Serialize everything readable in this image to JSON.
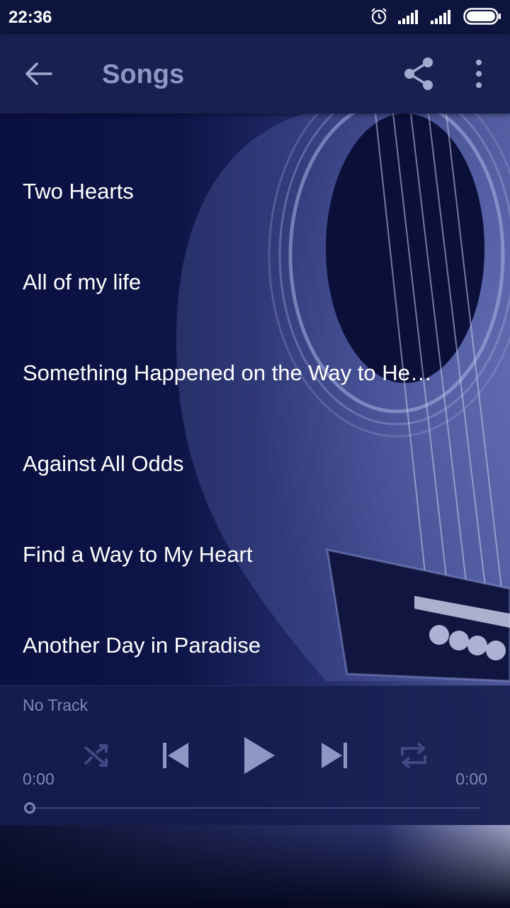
{
  "statusbar": {
    "time": "22:36"
  },
  "appbar": {
    "title": "Songs"
  },
  "songs": [
    {
      "title": "Two Hearts"
    },
    {
      "title": "All of my life"
    },
    {
      "title": "Something Happened on the Way to Heaven"
    },
    {
      "title": "Against All Odds"
    },
    {
      "title": "Find a Way to My Heart"
    },
    {
      "title": "Another Day in Paradise"
    }
  ],
  "player": {
    "track": "No Track",
    "time_elapsed": "0:00",
    "time_total": "0:00",
    "progress": 0
  },
  "colors": {
    "appbar": "#17204f",
    "statusbar": "#0d143d",
    "muted_text": "#7f88b4",
    "list_text": "#ffffff"
  },
  "icons": [
    "back-arrow-icon",
    "share-icon",
    "more-vert-icon",
    "shuffle-icon",
    "skip-previous-icon",
    "play-icon",
    "skip-next-icon",
    "repeat-icon",
    "alarm-icon",
    "signal-icon",
    "battery-icon"
  ]
}
